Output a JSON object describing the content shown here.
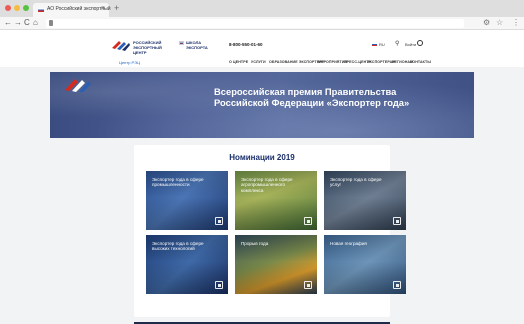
{
  "browser": {
    "tab_title": "АО Российский экспортный",
    "tab_close": "×",
    "new_tab": "+",
    "back": "←",
    "forward": "→",
    "reload": "C",
    "home": "⌂"
  },
  "header": {
    "logo1_text": "РОССИЙСКИЙ ЭКСПОРТНЫЙ ЦЕНТР",
    "logo2_text": "ШКОЛА ЭКСПОРТА",
    "phone": "8-800-550-01-60",
    "lang": "RU",
    "login": "Войти",
    "region": "Центр РЭЦ"
  },
  "nav": {
    "items": [
      "О ЦЕНТРЕ",
      "УСЛУГИ",
      "ОБРАЗОВАНИЕ ЭКСПОРТЕРУ",
      "МЕРОПРИЯТИЯ",
      "ПРЕСС-ЦЕНТР",
      "ЭКСПОРТЕРАМ",
      "РЕГИОНАМ",
      "КОНТАКТЫ"
    ]
  },
  "hero": {
    "title": "Всероссийская премия Правительства Российской Федерации «Экспортер года»"
  },
  "nominations": {
    "title": "Номинации 2019",
    "tiles": [
      {
        "label": "Экспортер года в сфере промышленности",
        "icon": "factory-icon"
      },
      {
        "label": "Экспортер года в сфере агропромышленного комплекса",
        "icon": "plant-icon"
      },
      {
        "label": "Экспортер года в сфере услуг",
        "icon": "building-icon"
      },
      {
        "label": "Экспортер года в сфере высоких технологий",
        "icon": "chip-icon"
      },
      {
        "label": "Прорыв года",
        "icon": "rocket-icon"
      },
      {
        "label": "Новая география",
        "icon": "globe-icon"
      }
    ]
  }
}
